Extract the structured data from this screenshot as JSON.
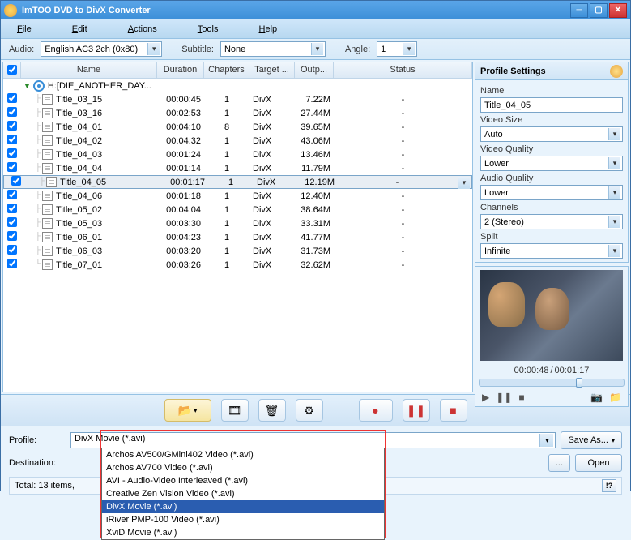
{
  "window": {
    "title": "ImTOO DVD to DivX Converter"
  },
  "menu": {
    "file": "File",
    "edit": "Edit",
    "actions": "Actions",
    "tools": "Tools",
    "help": "Help"
  },
  "selectors": {
    "audio_label": "Audio:",
    "audio_value": "English AC3 2ch (0x80)",
    "subtitle_label": "Subtitle:",
    "subtitle_value": "None",
    "angle_label": "Angle:",
    "angle_value": "1"
  },
  "grid": {
    "headers": {
      "name": "Name",
      "duration": "Duration",
      "chapters": "Chapters",
      "target": "Target ...",
      "output": "Outp...",
      "status": "Status"
    },
    "root": "H:[DIE_ANOTHER_DAY...",
    "rows": [
      {
        "name": "Title_03_15",
        "dur": "00:00:45",
        "ch": "1",
        "tgt": "DivX",
        "out": "7.22M",
        "st": "-"
      },
      {
        "name": "Title_03_16",
        "dur": "00:02:53",
        "ch": "1",
        "tgt": "DivX",
        "out": "27.44M",
        "st": "-"
      },
      {
        "name": "Title_04_01",
        "dur": "00:04:10",
        "ch": "8",
        "tgt": "DivX",
        "out": "39.65M",
        "st": "-"
      },
      {
        "name": "Title_04_02",
        "dur": "00:04:32",
        "ch": "1",
        "tgt": "DivX",
        "out": "43.06M",
        "st": "-"
      },
      {
        "name": "Title_04_03",
        "dur": "00:01:24",
        "ch": "1",
        "tgt": "DivX",
        "out": "13.46M",
        "st": "-"
      },
      {
        "name": "Title_04_04",
        "dur": "00:01:14",
        "ch": "1",
        "tgt": "DivX",
        "out": "11.79M",
        "st": "-"
      },
      {
        "name": "Title_04_05",
        "dur": "00:01:17",
        "ch": "1",
        "tgt": "DivX",
        "out": "12.19M",
        "st": "-",
        "selected": true
      },
      {
        "name": "Title_04_06",
        "dur": "00:01:18",
        "ch": "1",
        "tgt": "DivX",
        "out": "12.40M",
        "st": "-"
      },
      {
        "name": "Title_05_02",
        "dur": "00:04:04",
        "ch": "1",
        "tgt": "DivX",
        "out": "38.64M",
        "st": "-"
      },
      {
        "name": "Title_05_03",
        "dur": "00:03:30",
        "ch": "1",
        "tgt": "DivX",
        "out": "33.31M",
        "st": "-"
      },
      {
        "name": "Title_06_01",
        "dur": "00:04:23",
        "ch": "1",
        "tgt": "DivX",
        "out": "41.77M",
        "st": "-"
      },
      {
        "name": "Title_06_03",
        "dur": "00:03:20",
        "ch": "1",
        "tgt": "DivX",
        "out": "31.73M",
        "st": "-"
      },
      {
        "name": "Title_07_01",
        "dur": "00:03:26",
        "ch": "1",
        "tgt": "DivX",
        "out": "32.62M",
        "st": "-"
      }
    ]
  },
  "profile_settings": {
    "title": "Profile Settings",
    "name_label": "Name",
    "name_value": "Title_04_05",
    "vsize_label": "Video Size",
    "vsize_value": "Auto",
    "vq_label": "Video Quality",
    "vq_value": "Lower",
    "aq_label": "Audio Quality",
    "aq_value": "Lower",
    "ch_label": "Channels",
    "ch_value": "2 (Stereo)",
    "split_label": "Split",
    "split_value": "Infinite"
  },
  "preview": {
    "time_current": "00:00:48",
    "time_sep": " / ",
    "time_total": "00:01:17"
  },
  "bottom": {
    "profile_label": "Profile:",
    "profile_value": "DivX Movie  (*.avi)",
    "dest_label": "Destination:",
    "saveas": "Save As...",
    "open": "Open",
    "threedot": "...",
    "total": "Total: 13 items,",
    "warn": "!?"
  },
  "dropdown": {
    "options": [
      "Archos AV500/GMini402 Video  (*.avi)",
      "Archos AV700 Video  (*.avi)",
      "AVI - Audio-Video Interleaved  (*.avi)",
      "Creative Zen Vision Video  (*.avi)",
      "DivX Movie  (*.avi)",
      "iRiver PMP-100 Video  (*.avi)",
      "XviD Movie  (*.avi)"
    ],
    "highlighted": 4
  }
}
